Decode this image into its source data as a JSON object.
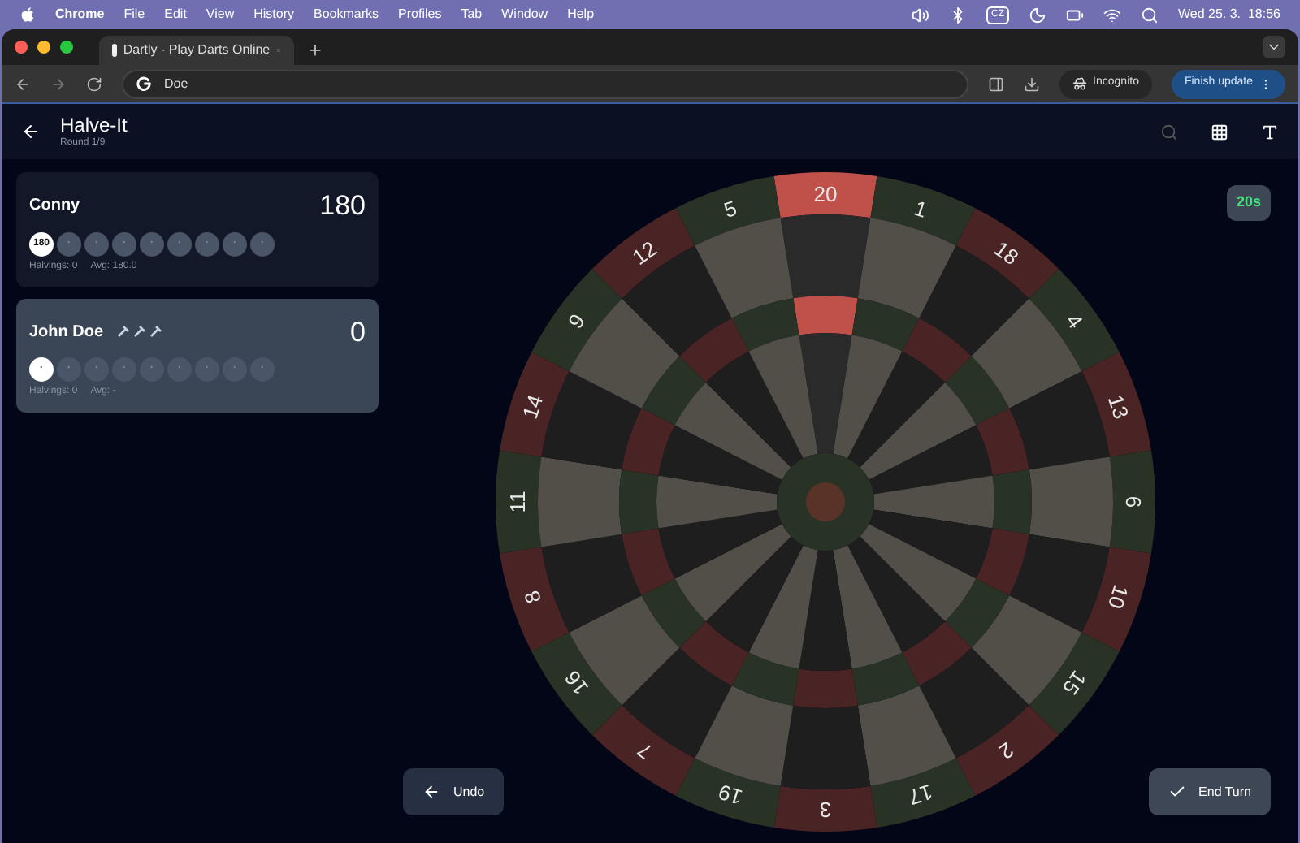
{
  "menubar": {
    "app": "Chrome",
    "items": [
      "File",
      "Edit",
      "View",
      "History",
      "Bookmarks",
      "Profiles",
      "Tab",
      "Window",
      "Help"
    ],
    "keyboard": "CZ",
    "clock": "Wed 25. 3.  18:56"
  },
  "browser": {
    "tab_title": "Dartly - Play Darts Online",
    "address": "Doe",
    "incognito": "Incognito",
    "update_button": "Finish update"
  },
  "header": {
    "title": "Halve-It",
    "subtitle": "Round 1/9"
  },
  "players": [
    {
      "name": "Conny",
      "score": "180",
      "active": false,
      "rounds": [
        {
          "label": "180",
          "current": true
        },
        {
          "label": "·",
          "current": false
        },
        {
          "label": "·",
          "current": false
        },
        {
          "label": "·",
          "current": false
        },
        {
          "label": "·",
          "current": false
        },
        {
          "label": "·",
          "current": false
        },
        {
          "label": "·",
          "current": false
        },
        {
          "label": "·",
          "current": false
        },
        {
          "label": "·",
          "current": false
        }
      ],
      "halvings": "Halvings: 0",
      "avg": "Avg: 180.0"
    },
    {
      "name": "John Doe",
      "score": "0",
      "active": true,
      "darts": [
        {
          "kind": "dart"
        },
        {
          "kind": "dart"
        },
        {
          "kind": "dart"
        }
      ],
      "rounds": [
        {
          "label": "·",
          "current": true
        },
        {
          "label": "·",
          "current": false
        },
        {
          "label": "·",
          "current": false
        },
        {
          "label": "·",
          "current": false
        },
        {
          "label": "·",
          "current": false
        },
        {
          "label": "·",
          "current": false
        },
        {
          "label": "·",
          "current": false
        },
        {
          "label": "·",
          "current": false
        },
        {
          "label": "·",
          "current": false
        }
      ],
      "halvings": "Halvings: 0",
      "avg": "Avg: -"
    }
  ],
  "timer": "20s",
  "board": {
    "segments": [
      {
        "number": "20",
        "highlighted": true
      },
      {
        "number": "1",
        "highlighted": false
      },
      {
        "number": "18",
        "highlighted": false
      },
      {
        "number": "4",
        "highlighted": false
      },
      {
        "number": "13",
        "highlighted": false
      },
      {
        "number": "6",
        "highlighted": false
      },
      {
        "number": "10",
        "highlighted": false
      },
      {
        "number": "15",
        "highlighted": false
      },
      {
        "number": "2",
        "highlighted": false
      },
      {
        "number": "17",
        "highlighted": false
      },
      {
        "number": "3",
        "highlighted": false
      },
      {
        "number": "19",
        "highlighted": false
      },
      {
        "number": "7",
        "highlighted": false
      },
      {
        "number": "16",
        "highlighted": false
      },
      {
        "number": "8",
        "highlighted": false
      },
      {
        "number": "11",
        "highlighted": false
      },
      {
        "number": "14",
        "highlighted": false
      },
      {
        "number": "9",
        "highlighted": false
      },
      {
        "number": "12",
        "highlighted": false
      },
      {
        "number": "5",
        "highlighted": false
      }
    ]
  },
  "buttons": {
    "undo": "Undo",
    "end_turn": "End Turn"
  }
}
